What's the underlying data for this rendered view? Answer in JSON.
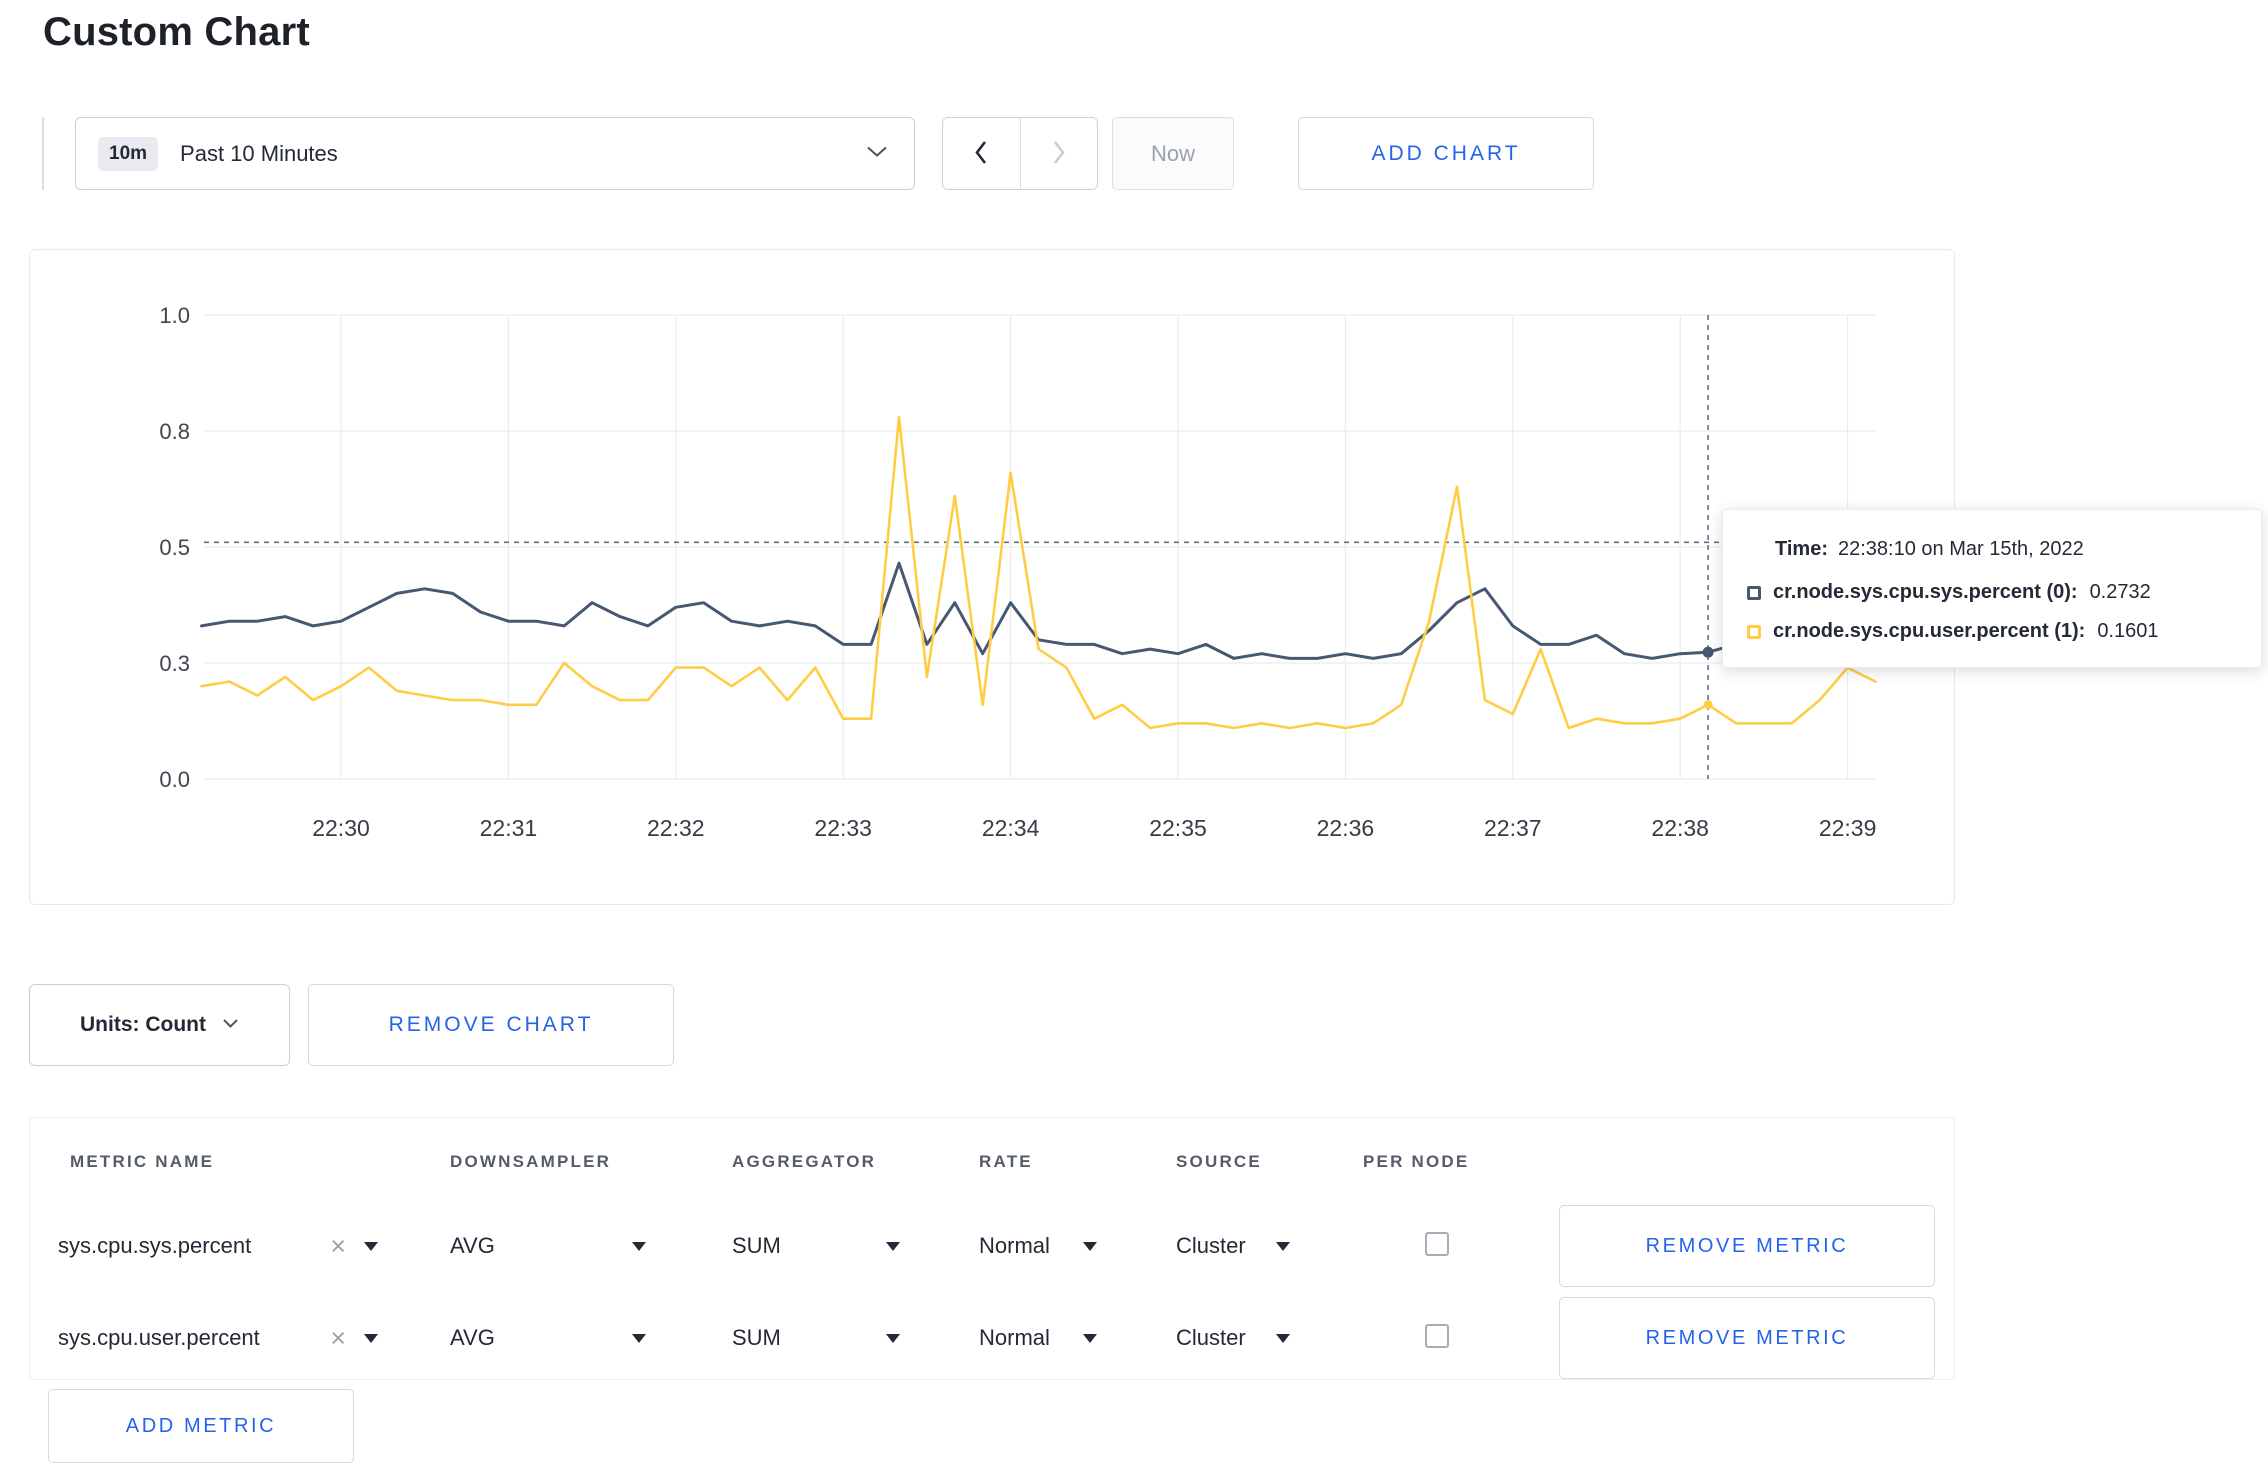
{
  "header": {
    "title": "Custom Chart"
  },
  "toolbar": {
    "time_badge": "10m",
    "time_label": "Past 10 Minutes",
    "now_label": "Now",
    "add_chart_label": "ADD CHART"
  },
  "chart_data": {
    "type": "line",
    "start_time": "22:29:10",
    "interval_seconds": 10,
    "x_tick_labels": [
      "22:30",
      "22:31",
      "22:32",
      "22:33",
      "22:34",
      "22:35",
      "22:36",
      "22:37",
      "22:38",
      "22:39"
    ],
    "y_ticks": [
      {
        "value": 0.0,
        "label": "0.0"
      },
      {
        "value": 0.25,
        "label": "0.3"
      },
      {
        "value": 0.5,
        "label": "0.5"
      },
      {
        "value": 0.75,
        "label": "0.8"
      },
      {
        "value": 1.0,
        "label": "1.0"
      }
    ],
    "ylim": [
      0,
      1
    ],
    "grid": true,
    "legend_position": "none",
    "series": [
      {
        "name": "cr.node.sys.cpu.sys.percent",
        "color": "#475872",
        "values": [
          0.33,
          0.34,
          0.34,
          0.35,
          0.33,
          0.34,
          0.37,
          0.4,
          0.41,
          0.4,
          0.36,
          0.34,
          0.34,
          0.33,
          0.38,
          0.35,
          0.33,
          0.37,
          0.38,
          0.34,
          0.33,
          0.34,
          0.33,
          0.29,
          0.29,
          0.465,
          0.29,
          0.38,
          0.27,
          0.38,
          0.3,
          0.29,
          0.29,
          0.27,
          0.28,
          0.27,
          0.29,
          0.26,
          0.27,
          0.26,
          0.26,
          0.27,
          0.26,
          0.27,
          0.32,
          0.38,
          0.41,
          0.33,
          0.29,
          0.29,
          0.31,
          0.27,
          0.26,
          0.27,
          0.2732,
          0.29,
          0.28,
          0.29,
          0.3,
          0.29,
          0.3
        ]
      },
      {
        "name": "cr.node.sys.cpu.user.percent",
        "color": "#FFCD44",
        "values": [
          0.2,
          0.21,
          0.18,
          0.22,
          0.17,
          0.2,
          0.24,
          0.19,
          0.18,
          0.17,
          0.17,
          0.16,
          0.16,
          0.25,
          0.2,
          0.17,
          0.17,
          0.24,
          0.24,
          0.2,
          0.24,
          0.17,
          0.24,
          0.13,
          0.13,
          0.78,
          0.22,
          0.61,
          0.16,
          0.66,
          0.28,
          0.24,
          0.13,
          0.16,
          0.11,
          0.12,
          0.12,
          0.11,
          0.12,
          0.11,
          0.12,
          0.11,
          0.12,
          0.16,
          0.34,
          0.63,
          0.17,
          0.14,
          0.28,
          0.11,
          0.13,
          0.12,
          0.12,
          0.13,
          0.1601,
          0.12,
          0.12,
          0.12,
          0.17,
          0.24,
          0.21
        ]
      }
    ],
    "crosshair": {
      "time": "22:38:10",
      "y_value": 0.51,
      "points": [
        {
          "series": 0,
          "value": 0.2732
        },
        {
          "series": 1,
          "value": 0.1601
        }
      ]
    }
  },
  "tooltip": {
    "time_label": "Time:",
    "time_value": "22:38:10 on Mar 15th, 2022",
    "rows": [
      {
        "name": "cr.node.sys.cpu.sys.percent (0):",
        "value": "0.2732",
        "color": "#475872"
      },
      {
        "name": "cr.node.sys.cpu.user.percent (1):",
        "value": "0.1601",
        "color": "#FFCD44"
      }
    ]
  },
  "chart_controls": {
    "units_label": "Units: Count",
    "remove_chart_label": "REMOVE CHART"
  },
  "metrics_table": {
    "columns": [
      "METRIC NAME",
      "DOWNSAMPLER",
      "AGGREGATOR",
      "RATE",
      "SOURCE",
      "PER NODE"
    ],
    "rows": [
      {
        "metric": "sys.cpu.sys.percent",
        "downsampler": "AVG",
        "aggregator": "SUM",
        "rate": "Normal",
        "source": "Cluster",
        "per_node": false,
        "remove_label": "REMOVE METRIC"
      },
      {
        "metric": "sys.cpu.user.percent",
        "downsampler": "AVG",
        "aggregator": "SUM",
        "rate": "Normal",
        "source": "Cluster",
        "per_node": false,
        "remove_label": "REMOVE METRIC"
      }
    ],
    "add_metric_label": "ADD METRIC"
  },
  "colors": {
    "accent_blue": "#2563eb",
    "series_sys": "#475872",
    "series_user": "#FFCD44",
    "grid": "#ebecef",
    "crosshair": "#475872"
  }
}
